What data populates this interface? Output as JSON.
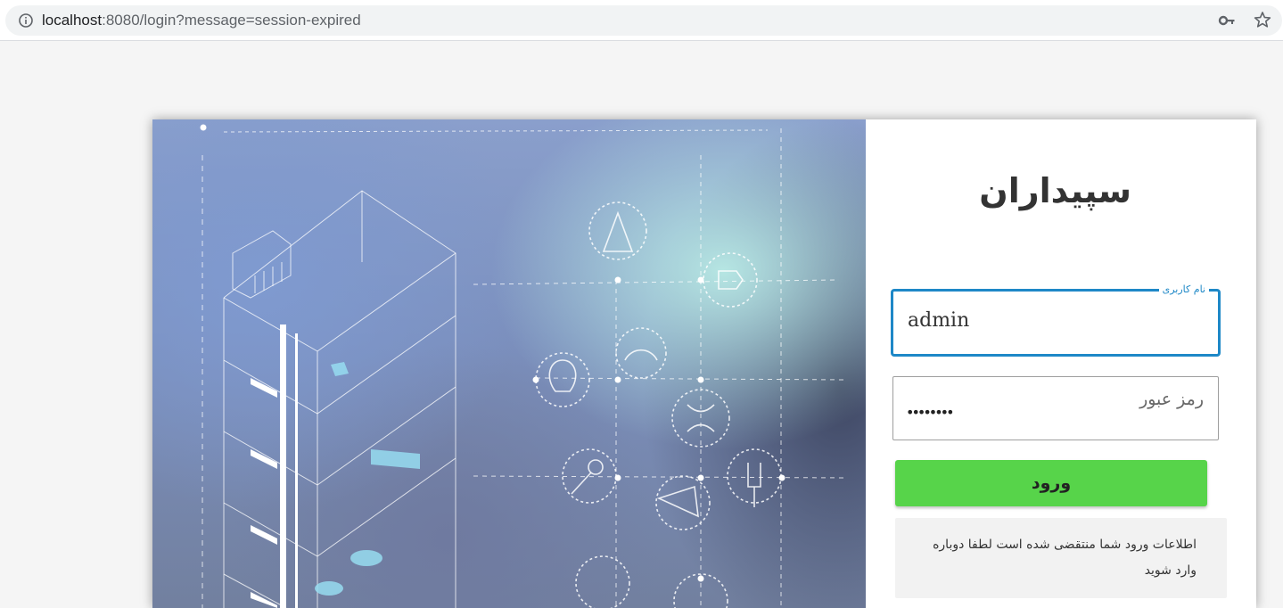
{
  "browser": {
    "url_host": "localhost",
    "url_rest": ":8080/login?message=session-expired",
    "icons": [
      "info-icon",
      "key-icon",
      "star-icon"
    ]
  },
  "login": {
    "brand": "سپیداران",
    "username_label": "نام کاربری",
    "username_value": "admin",
    "password_placeholder": "رمز عبور",
    "password_mask": "••••••••",
    "submit_label": "ورود",
    "message": "اطلاعات ورود شما منتقضی شده است لطفا دوباره وارد شوید"
  },
  "colors": {
    "accent": "#1e88c7",
    "button": "#57d44a",
    "alert_bg": "#f2f2f2"
  }
}
